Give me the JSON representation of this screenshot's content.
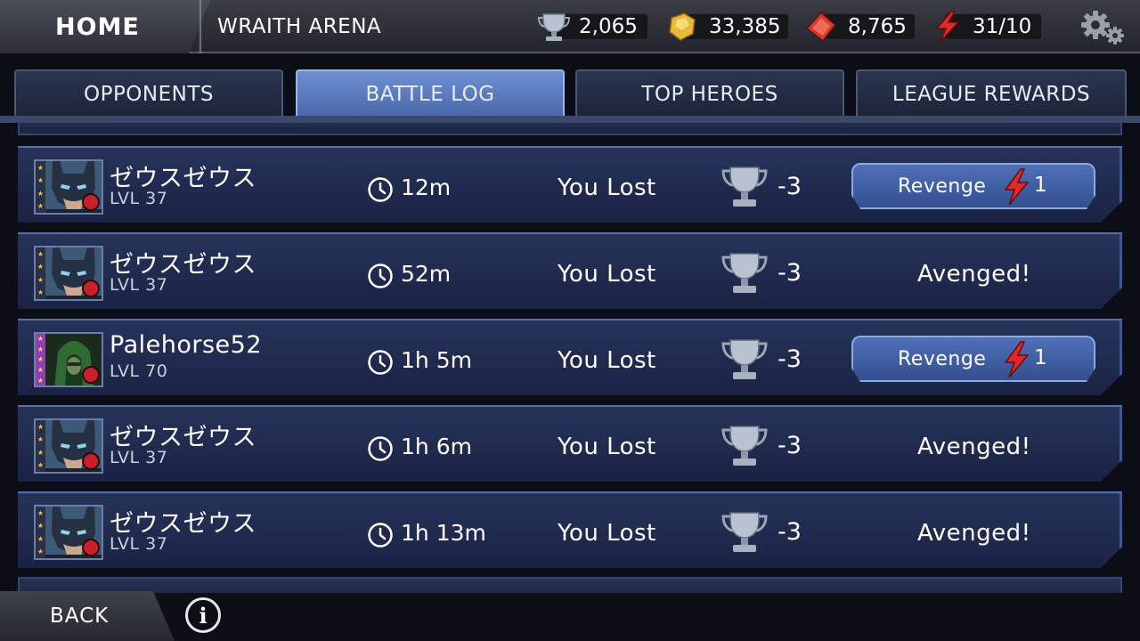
{
  "header": {
    "home_label": "HOME",
    "arena_title": "WRAITH ARENA",
    "trophies": "2,065",
    "gold": "33,385",
    "gems": "8,765",
    "energy": "31/10"
  },
  "tabs": [
    {
      "label": "OPPONENTS"
    },
    {
      "label": "BATTLE LOG"
    },
    {
      "label": "TOP HEROES"
    },
    {
      "label": "LEAGUE REWARDS"
    }
  ],
  "battles": [
    {
      "name": "ゼウスゼウス",
      "level": "LVL 37",
      "time": "12m",
      "result": "You Lost",
      "trophy_change": "-3",
      "action": "revenge",
      "revenge_label": "Revenge",
      "revenge_cost": "1"
    },
    {
      "name": "ゼウスゼウス",
      "level": "LVL 37",
      "time": "52m",
      "result": "You Lost",
      "trophy_change": "-3",
      "action": "avenged",
      "avenged_label": "Avenged!"
    },
    {
      "name": "Palehorse52",
      "level": "LVL 70",
      "time": "1h 5m",
      "result": "You Lost",
      "trophy_change": "-3",
      "action": "revenge",
      "revenge_label": "Revenge",
      "revenge_cost": "1"
    },
    {
      "name": "ゼウスゼウス",
      "level": "LVL 37",
      "time": "1h 6m",
      "result": "You Lost",
      "trophy_change": "-3",
      "action": "avenged",
      "avenged_label": "Avenged!"
    },
    {
      "name": "ゼウスゼウス",
      "level": "LVL 37",
      "time": "1h 13m",
      "result": "You Lost",
      "trophy_change": "-3",
      "action": "avenged",
      "avenged_label": "Avenged!"
    }
  ],
  "footer": {
    "back_label": "BACK",
    "info_label": "i"
  },
  "colors": {
    "active_tab": "#5b7cc0",
    "row_bg": "#1f2a4d",
    "energy_red": "#e02828",
    "gold": "#e8b83a"
  }
}
